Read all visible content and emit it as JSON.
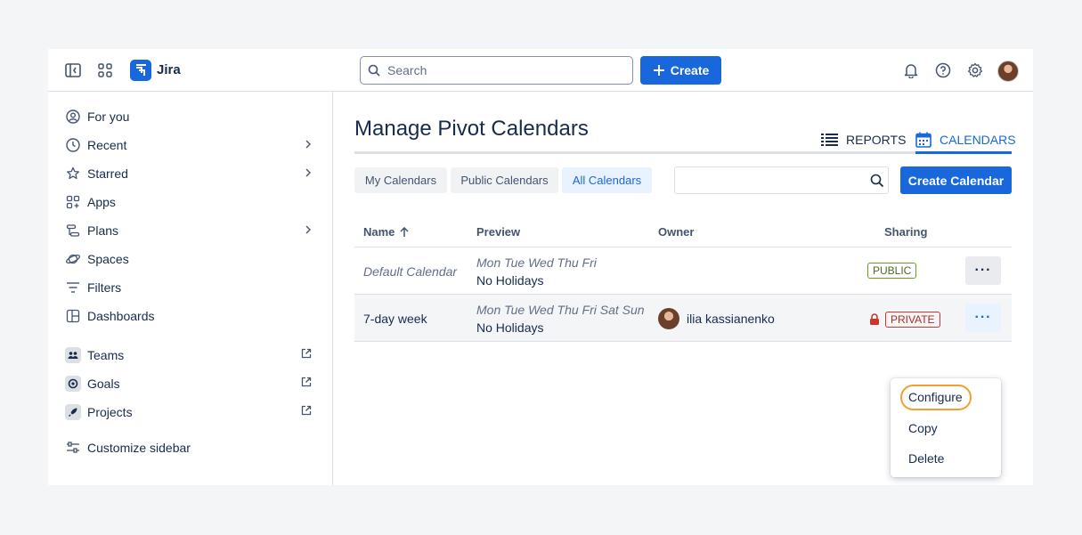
{
  "topbar": {
    "app_name": "Jira",
    "search_placeholder": "Search",
    "create_label": "Create"
  },
  "sidebar": {
    "items": [
      {
        "label": "For you"
      },
      {
        "label": "Recent"
      },
      {
        "label": "Starred"
      },
      {
        "label": "Apps"
      },
      {
        "label": "Plans"
      },
      {
        "label": "Spaces"
      },
      {
        "label": "Filters"
      },
      {
        "label": "Dashboards"
      },
      {
        "label": "Teams"
      },
      {
        "label": "Goals"
      },
      {
        "label": "Projects"
      },
      {
        "label": "Customize sidebar"
      }
    ]
  },
  "main": {
    "title": "Manage Pivot Calendars",
    "view_tabs": {
      "reports": "REPORTS",
      "calendars": "CALENDARS"
    },
    "filters": [
      "My Calendars",
      "Public Calendars",
      "All Calendars"
    ],
    "create_calendar_label": "Create Calendar",
    "columns": [
      "Name",
      "Preview",
      "Owner",
      "Sharing"
    ],
    "rows": [
      {
        "name": "Default Calendar",
        "preview_days": "Mon Tue Wed Thu Fri",
        "preview_holidays": "No Holidays",
        "owner": "",
        "sharing": "PUBLIC"
      },
      {
        "name": "7-day week",
        "preview_days": "Mon Tue Wed Thu Fri Sat Sun",
        "preview_holidays": "No Holidays",
        "owner": "ilia kassianenko",
        "sharing": "PRIVATE"
      }
    ],
    "more_label": "···",
    "menu": [
      "Configure",
      "Copy",
      "Delete"
    ]
  },
  "colors": {
    "brand": "#1868db",
    "public": "#4c6b1f",
    "private": "#ae2e24",
    "focus_ring": "#f0a030"
  }
}
